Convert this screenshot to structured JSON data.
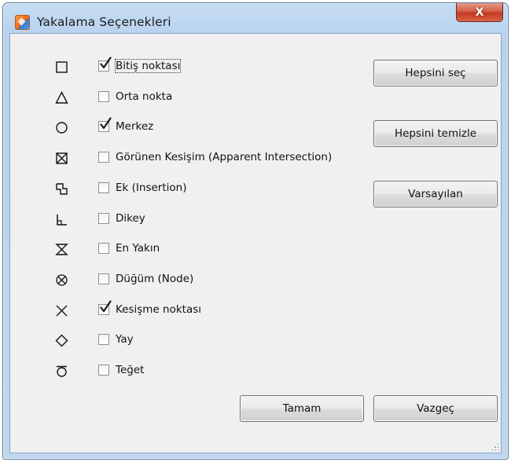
{
  "window": {
    "title": "Yakalama Seçenekleri",
    "close_label": "X"
  },
  "options": [
    {
      "icon": "endpoint-square-icon",
      "label": "Bitiş noktası",
      "checked": true,
      "focused": true
    },
    {
      "icon": "midpoint-triangle-icon",
      "label": "Orta nokta",
      "checked": false
    },
    {
      "icon": "center-circle-icon",
      "label": "Merkez",
      "checked": true
    },
    {
      "icon": "apparent-intersection-icon",
      "label": "Görünen Kesişim (Apparent Intersection)",
      "checked": false
    },
    {
      "icon": "insertion-icon",
      "label": "Ek (Insertion)",
      "checked": false
    },
    {
      "icon": "perpendicular-icon",
      "label": "Dikey",
      "checked": false
    },
    {
      "icon": "nearest-hourglass-icon",
      "label": "En Yakın",
      "checked": false
    },
    {
      "icon": "node-icon",
      "label": "Düğüm (Node)",
      "checked": false
    },
    {
      "icon": "intersection-x-icon",
      "label": "Kesişme noktası",
      "checked": true
    },
    {
      "icon": "quadrant-diamond-icon",
      "label": "Yay",
      "checked": false
    },
    {
      "icon": "tangent-icon",
      "label": "Teğet",
      "checked": false
    }
  ],
  "buttons": {
    "select_all": "Hepsini seç",
    "clear_all": "Hepsini temizle",
    "defaults": "Varsayılan",
    "ok": "Tamam",
    "cancel": "Vazgeç"
  }
}
